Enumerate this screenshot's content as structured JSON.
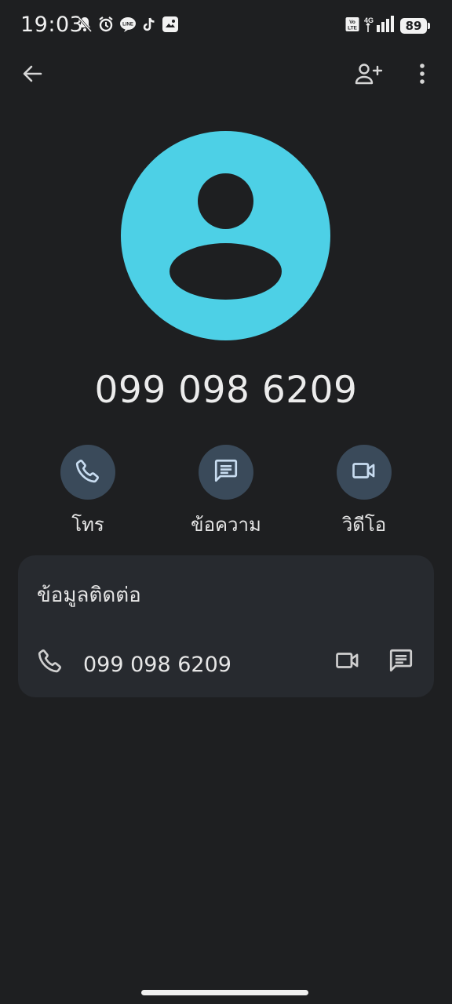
{
  "status_bar": {
    "time": "19:03",
    "network": "4G",
    "volte": "Vo LTE",
    "battery": "89",
    "left_icons": [
      "bell-off-icon",
      "alarm-icon",
      "line-app-icon",
      "tiktok-icon",
      "gallery-icon"
    ]
  },
  "app_bar": {
    "back_icon": "arrow-back-icon",
    "add_contact_icon": "person-add-icon",
    "more_icon": "more-vert-icon"
  },
  "contact": {
    "title": "099 098 6209",
    "avatar_color": "#4dd0e6"
  },
  "actions": [
    {
      "label": "โทร",
      "icon": "phone-icon"
    },
    {
      "label": "ข้อความ",
      "icon": "message-icon"
    },
    {
      "label": "วิดีโอ",
      "icon": "videocam-icon"
    }
  ],
  "info_card": {
    "title": "ข้อมูลติดต่อ",
    "phone_number": "099 098 6209"
  },
  "colors": {
    "background": "#1e1f21",
    "card": "#272a2f",
    "action_circle": "#3a4a5a",
    "avatar": "#4dd0e6",
    "icon_light": "#c8dcf0"
  }
}
